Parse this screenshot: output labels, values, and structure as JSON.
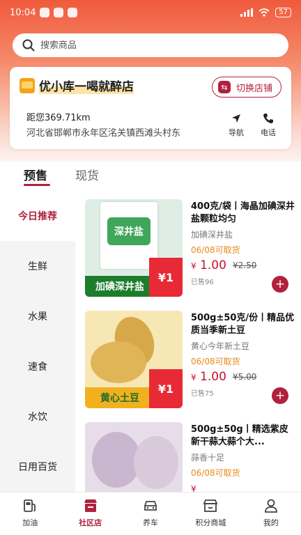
{
  "status_bar": {
    "time": "10:04",
    "battery": "57"
  },
  "search": {
    "placeholder": "搜索商品"
  },
  "store": {
    "name": "优小库一喝就醉店",
    "switch_label": "切换店铺",
    "distance": "距您369.71km",
    "address": "河北省邯郸市永年区洺关镇西滩头村东",
    "nav_label": "导航",
    "phone_label": "电话"
  },
  "tabs": [
    {
      "label": "预售",
      "active": true
    },
    {
      "label": "现货",
      "active": false
    }
  ],
  "categories": [
    {
      "label": "今日推荐",
      "active": true
    },
    {
      "label": "生鲜"
    },
    {
      "label": "水果"
    },
    {
      "label": "速食"
    },
    {
      "label": "水饮"
    },
    {
      "label": "日用百货"
    }
  ],
  "products": [
    {
      "title": "400克/袋丨海晶加碘深井盐颗粒均匀",
      "subtitle": "加碘深井盐",
      "date": "06/08可取货",
      "price_symbol": "¥",
      "price": "1.00",
      "original_price": "¥2.50",
      "sold": "已售96",
      "image_label": "加碘深井盐",
      "image_price": "¥1",
      "image_colors": [
        "#dfeee4",
        "#1c7d2c"
      ]
    },
    {
      "title": "500g±50克/份丨精品优质当季新土豆",
      "subtitle": "黄心今年新土豆",
      "date": "06/08可取货",
      "price_symbol": "¥",
      "price": "1.00",
      "original_price": "¥5.00",
      "sold": "已售75",
      "image_label": "黄心土豆",
      "image_price": "¥1",
      "image_colors": [
        "#f6e7b4",
        "#f2b01e"
      ]
    },
    {
      "title": "500g±50g丨精选紫皮新干蒜大蒜个大...",
      "subtitle": "蒜香十足",
      "date": "06/08可取货",
      "price_symbol": "¥",
      "price": "",
      "original_price": "",
      "sold": "",
      "image_label": "",
      "image_price": "",
      "image_colors": [
        "#e6dde8",
        "#9a7fa2"
      ]
    }
  ],
  "bottom_nav": [
    {
      "label": "加油",
      "icon": "fuel-icon"
    },
    {
      "label": "社区店",
      "icon": "store-icon",
      "active": true
    },
    {
      "label": "养车",
      "icon": "car-icon"
    },
    {
      "label": "积分商城",
      "icon": "shop-icon"
    },
    {
      "label": "我的",
      "icon": "person-icon"
    }
  ],
  "colors": {
    "accent": "#b0213e",
    "price": "#c8102e",
    "date": "#e88a1a",
    "top_gradient": "#f05a3c"
  }
}
